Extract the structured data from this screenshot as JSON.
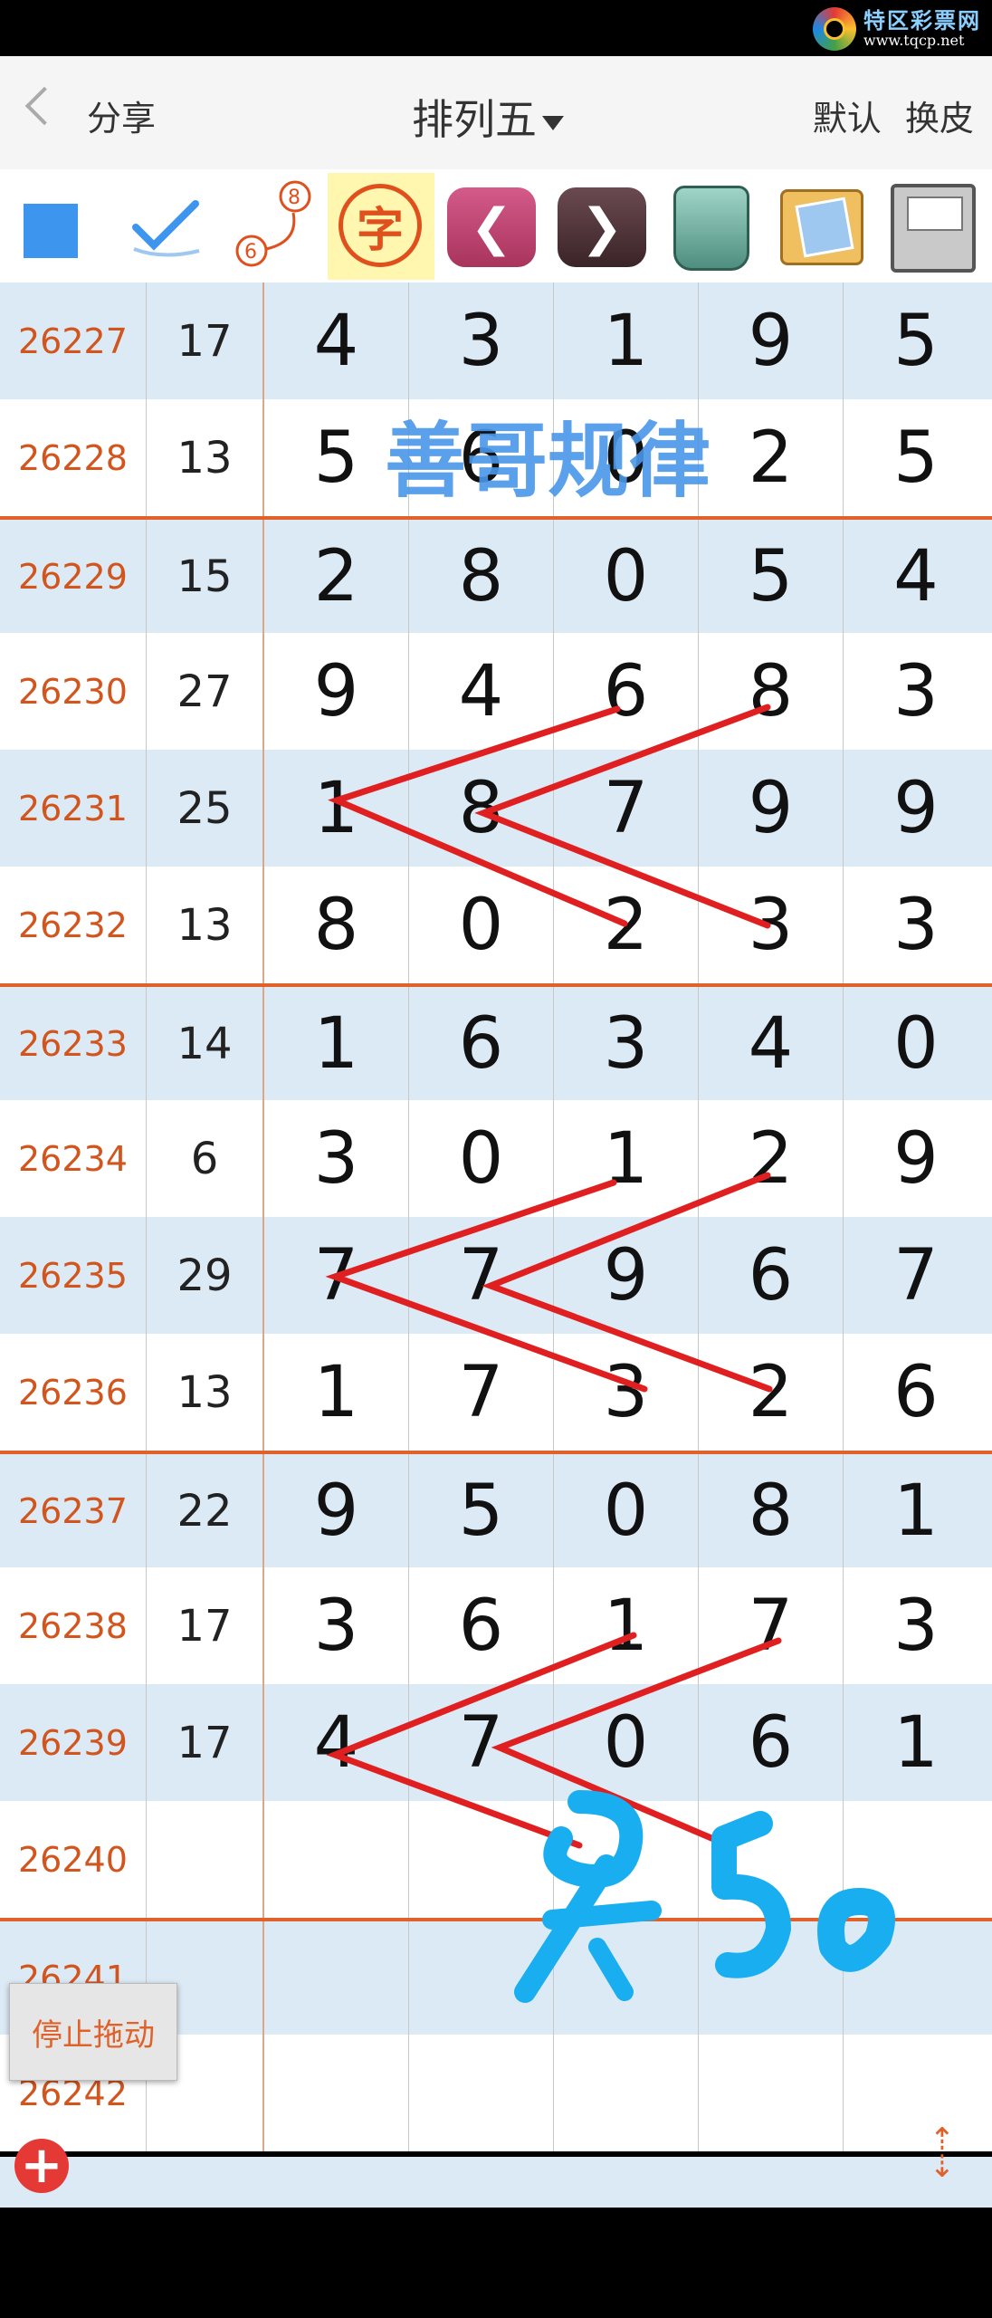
{
  "logo": {
    "name": "特区彩票网",
    "url": "www.tqcp.net"
  },
  "header": {
    "share": "分享",
    "title": "排列五",
    "default": "默认",
    "skin": "换皮"
  },
  "toolbar": {
    "zi_label": "字"
  },
  "rows": [
    {
      "period": "26227",
      "sum": "17",
      "digits": [
        "4",
        "3",
        "1",
        "9",
        "5"
      ]
    },
    {
      "period": "26228",
      "sum": "13",
      "digits": [
        "5",
        "6",
        "0",
        "2",
        "5"
      ]
    },
    {
      "period": "26229",
      "sum": "15",
      "digits": [
        "2",
        "8",
        "0",
        "5",
        "4"
      ]
    },
    {
      "period": "26230",
      "sum": "27",
      "digits": [
        "9",
        "4",
        "6",
        "8",
        "3"
      ]
    },
    {
      "period": "26231",
      "sum": "25",
      "digits": [
        "1",
        "8",
        "7",
        "9",
        "9"
      ]
    },
    {
      "period": "26232",
      "sum": "13",
      "digits": [
        "8",
        "0",
        "2",
        "3",
        "3"
      ]
    },
    {
      "period": "26233",
      "sum": "14",
      "digits": [
        "1",
        "6",
        "3",
        "4",
        "0"
      ]
    },
    {
      "period": "26234",
      "sum": "6",
      "digits": [
        "3",
        "0",
        "1",
        "2",
        "9"
      ]
    },
    {
      "period": "26235",
      "sum": "29",
      "digits": [
        "7",
        "7",
        "9",
        "6",
        "7"
      ]
    },
    {
      "period": "26236",
      "sum": "13",
      "digits": [
        "1",
        "7",
        "3",
        "2",
        "6"
      ]
    },
    {
      "period": "26237",
      "sum": "22",
      "digits": [
        "9",
        "5",
        "0",
        "8",
        "1"
      ]
    },
    {
      "period": "26238",
      "sum": "17",
      "digits": [
        "3",
        "6",
        "1",
        "7",
        "3"
      ]
    },
    {
      "period": "26239",
      "sum": "17",
      "digits": [
        "4",
        "7",
        "0",
        "6",
        "1"
      ]
    },
    {
      "period": "26240",
      "sum": "",
      "digits": [
        "",
        "",
        "",
        "",
        ""
      ]
    },
    {
      "period": "26241",
      "sum": "",
      "digits": [
        "",
        "",
        "",
        "",
        ""
      ]
    },
    {
      "period": "26242",
      "sum": "",
      "digits": [
        "",
        "",
        "",
        "",
        ""
      ]
    }
  ],
  "watermark": "善哥规律",
  "handwriting": "Ā50",
  "stop_drag": "停止拖动",
  "colors": {
    "period_text": "#d2551e",
    "row_blue": "#dceaf6",
    "separator": "#e0622a",
    "watermark": "#4a96e8",
    "pen_red": "#e02020",
    "pen_blue": "#18aef0"
  }
}
